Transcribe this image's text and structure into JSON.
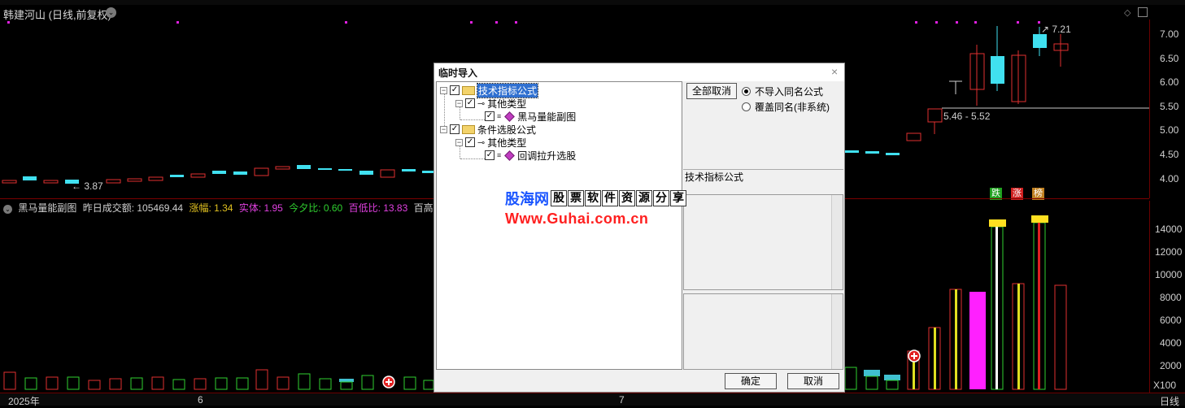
{
  "chart": {
    "title": "韩建河山 (日线,前复权)",
    "price_axis": [
      "7.00",
      "6.50",
      "6.00",
      "5.50",
      "5.00",
      "4.50",
      "4.00"
    ],
    "volume_axis": [
      "14000",
      "12000",
      "10000",
      "8000",
      "6000",
      "4000",
      "2000"
    ],
    "volume_unit": "X100",
    "low_marker": "3.87",
    "high_marker": "7.21",
    "range_marker": "5.46 - 5.52",
    "period": "日线",
    "dates": [
      "2025年",
      "6",
      "7"
    ],
    "signal_badges": [
      {
        "text": "跌",
        "color": "#1fa01f"
      },
      {
        "text": "涨",
        "color": "#d02020"
      },
      {
        "text": "榜",
        "color": "#c08020"
      }
    ]
  },
  "indicator": {
    "name": "黑马量能副图",
    "items": [
      {
        "text": "昨日成交额: 105469.44",
        "color": "#d0d0d0"
      },
      {
        "text": "涨幅: 1.34",
        "color": "#e0c020"
      },
      {
        "text": "实体: 1.95",
        "color": "#e040e0"
      },
      {
        "text": "今夕比: 0.60",
        "color": "#30d030"
      },
      {
        "text": "百低比: 13.83",
        "color": "#e040e0"
      },
      {
        "text": "百高比",
        "color": "#d0d0d0"
      }
    ]
  },
  "watermark": {
    "logo": "股海网",
    "boxes": [
      "股",
      "票",
      "软",
      "件",
      "资",
      "源",
      "分",
      "享"
    ],
    "url": "Www.Guhai.com.cn"
  },
  "dialog": {
    "title": "临时导入",
    "close": "×",
    "tree": [
      {
        "label": "技术指标公式",
        "level": 0,
        "selected": true
      },
      {
        "label": "其他类型",
        "level": 1
      },
      {
        "label": "黑马量能副图",
        "level": 2
      },
      {
        "label": "条件选股公式",
        "level": 0
      },
      {
        "label": "其他类型",
        "level": 1
      },
      {
        "label": "回调拉升选股",
        "level": 2
      }
    ],
    "cancel_all": "全部取消",
    "radio_no_import": "不导入同名公式",
    "radio_overwrite": "覆盖同名(非系统)",
    "description": "技术指标公式",
    "ok": "确定",
    "cancel": "取消"
  }
}
